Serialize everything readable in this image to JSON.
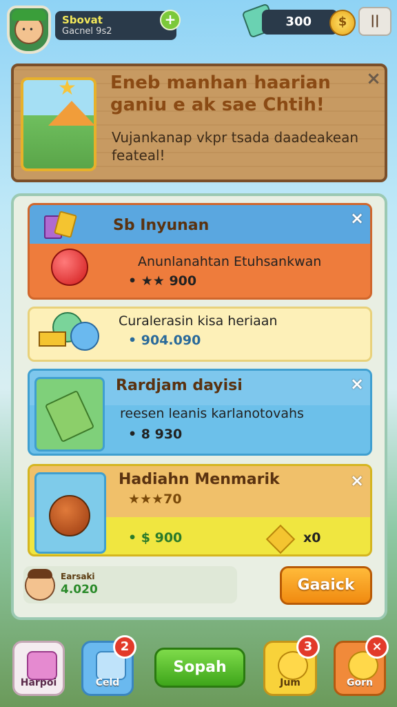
{
  "hud": {
    "player_name": "Sbovat",
    "player_sub": "Gacnel 9s2",
    "plus_label": "+",
    "gem_count": "300",
    "pause_label": "||"
  },
  "banner": {
    "title_line1": "Eneb manhan haarian",
    "title_line2": "ganiu e ak sae Chtih!",
    "subtitle_line1": "Vujankanap vkpr tsada daadeakean",
    "subtitle_line2": "feateal!",
    "close_label": "×"
  },
  "cards": [
    {
      "title": "Sb Inyunan",
      "desc": "Anunlanahtan Etuhsankwan",
      "value": "• ★★ 900",
      "close": "×"
    },
    {
      "title": "",
      "desc": "Curalerasin kisa heriaan",
      "value": "• 904.090",
      "close": ""
    },
    {
      "title": "Rardjam dayisi",
      "desc": "reesen leanis karlanotovahs",
      "value": "• 8 930",
      "close": "×"
    },
    {
      "title": "Hadiahn Menmarik",
      "desc": "★★★70",
      "value": "• $ 900",
      "extra_value": "x0",
      "close": "×"
    }
  ],
  "footer": {
    "user_label": "Earsaki",
    "user_value": "4.020",
    "claim_label": "Gaaick"
  },
  "nav": {
    "items": [
      {
        "label": "Harpoi",
        "badge": ""
      },
      {
        "label": "Celd",
        "badge": "2"
      },
      {
        "label": "Sopah",
        "badge": ""
      },
      {
        "label": "Jum",
        "badge": "3"
      },
      {
        "label": "Gorn",
        "badge": "×"
      }
    ]
  },
  "colors": {
    "accent_orange": "#f08a10",
    "accent_green": "#3ea51a",
    "card_orange": "#ee7c3c",
    "card_blue": "#6cc0ea",
    "card_yellow": "#f0e640"
  }
}
